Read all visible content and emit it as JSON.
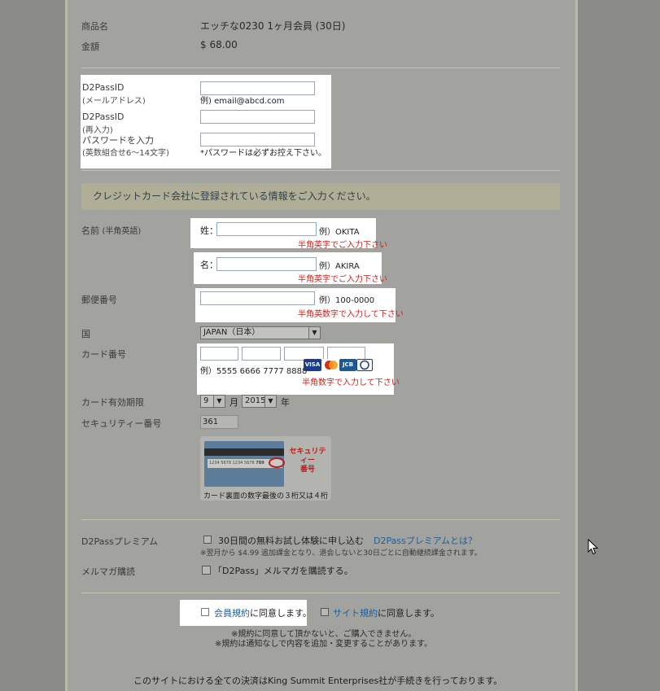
{
  "product": {
    "name_label": "商品名",
    "name_value": "エッチな0230 1ヶ月会員 (30日)",
    "price_label": "金額",
    "price_value": "$ 68.00"
  },
  "account": {
    "id_label": "D2PassID",
    "id_sub": "(メールアドレス)",
    "id_example": "例) email@abcd.com",
    "id_confirm_label": "D2PassID",
    "id_confirm_sub": "(再入力)",
    "password_label": "パスワードを入力",
    "password_sub": "(英数組合せ6～14文字)",
    "password_note": "*パスワードは必ずお控え下さい。"
  },
  "info_banner": "クレジットカード会社に登録されている情報をご入力ください。",
  "name": {
    "label": "名前",
    "label_sub": "(半角英語)",
    "last_prefix": "姓：",
    "last_example": "例）OKITA",
    "last_warning": "半角英字でご入力下さい",
    "first_prefix": "名：",
    "first_example": "例）AKIRA",
    "first_warning": "半角英字でご入力下さい"
  },
  "postal": {
    "label": "郵便番号",
    "example": "例）100-0000",
    "warning": "半角英数字で入力して下さい"
  },
  "country": {
    "label": "国",
    "selected": "JAPAN（日本）"
  },
  "card": {
    "label": "カード番号",
    "example": "例）5555 6666 7777 8888",
    "warning": "半角数字で入力して下さい",
    "brands": [
      "VISA",
      "MC",
      "JCB",
      "D"
    ]
  },
  "expiry": {
    "label": "カード有効期限",
    "month": "9",
    "month_unit": "月",
    "year": "2015",
    "year_unit": "年"
  },
  "security": {
    "label": "セキュリティー番号",
    "value": "361",
    "image_numbers": "1234 5678 1234 5678",
    "image_cvv": "789",
    "image_label_1": "セキュリティー",
    "image_label_2": "番号",
    "image_caption": "カード裏面の数字最後の３桁又は４桁"
  },
  "premium": {
    "label": "D2Passプレミアム",
    "checkbox_text": "30日間の無料お試し体験に申し込む",
    "link": "D2Passプレミアムとは？",
    "note": "※翌月から $4.99 追加課金となり、退会しないと30日ごとに自動継続課金されます。"
  },
  "newsletter": {
    "label": "メルマガ購読",
    "checkbox_text": "「D2Pass」メルマガを購読する。"
  },
  "terms": {
    "member_link": "会員規約",
    "member_text": "に同意します。",
    "site_link": "サイト規約",
    "site_text": "に同意します。",
    "note_1": "※規約に同意して頂かないと、ご購入できません。",
    "note_2": "※規約は通知なしで内容を追加・変更することがあります。"
  },
  "footer": "このサイトにおける全ての決済はKing Summit Enterprises社が手続きを行っております。",
  "colors": {
    "overlay_bg": "#8a8a86",
    "panel_bg": "#a2a29e",
    "highlight": "#ffffff",
    "warning_red": "#c8231e",
    "link_blue": "#1f5e9a"
  }
}
